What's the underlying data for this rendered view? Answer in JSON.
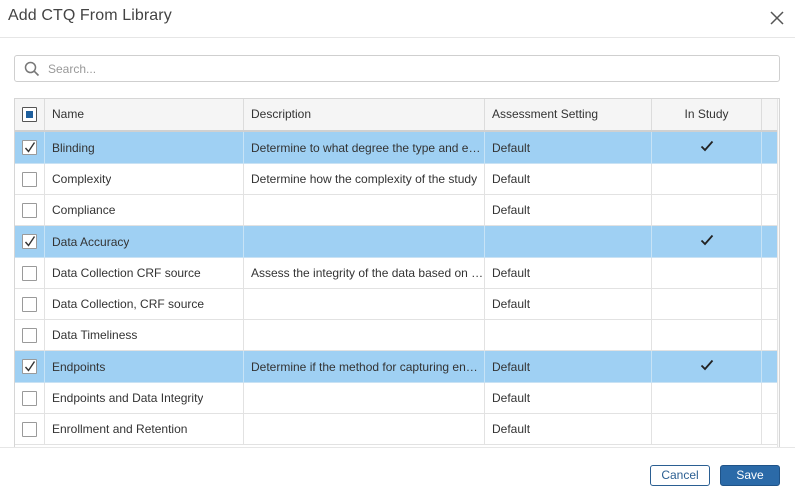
{
  "dialog": {
    "title": "Add CTQ From Library",
    "close_icon": "close-icon"
  },
  "search": {
    "placeholder": "Search...",
    "value": "",
    "icon": "search-icon"
  },
  "table": {
    "header_checkbox_state": "partial",
    "columns": [
      "Name",
      "Description",
      "Assessment Setting",
      "In Study"
    ],
    "rows": [
      {
        "checked": true,
        "name": "Blinding",
        "description": "Determine to what degree the type and extent of blinding",
        "assessment": "Default",
        "in_study": true
      },
      {
        "checked": false,
        "name": "Complexity",
        "description": "Determine how the complexity of the study",
        "assessment": "Default",
        "in_study": false
      },
      {
        "checked": false,
        "name": "Compliance",
        "description": "",
        "assessment": "Default",
        "in_study": false
      },
      {
        "checked": true,
        "name": "Data Accuracy",
        "description": "",
        "assessment": "",
        "in_study": true
      },
      {
        "checked": false,
        "name": "Data Collection CRF source",
        "description": "Assess the integrity of the data based on source",
        "assessment": "Default",
        "in_study": false
      },
      {
        "checked": false,
        "name": "Data Collection, CRF source",
        "description": "",
        "assessment": "Default",
        "in_study": false
      },
      {
        "checked": false,
        "name": "Data Timeliness",
        "description": "",
        "assessment": "",
        "in_study": false
      },
      {
        "checked": true,
        "name": "Endpoints",
        "description": "Determine if the method for capturing endpoints",
        "assessment": "Default",
        "in_study": true
      },
      {
        "checked": false,
        "name": "Endpoints and Data Integrity",
        "description": "",
        "assessment": "Default",
        "in_study": false
      },
      {
        "checked": false,
        "name": "Enrollment and Retention",
        "description": "",
        "assessment": "Default",
        "in_study": false
      }
    ]
  },
  "footer": {
    "cancel_label": "Cancel",
    "save_label": "Save"
  },
  "colors": {
    "selected_row": "#9fd0f3",
    "primary": "#2b6aa8",
    "header_bg": "#f5f5f5"
  }
}
